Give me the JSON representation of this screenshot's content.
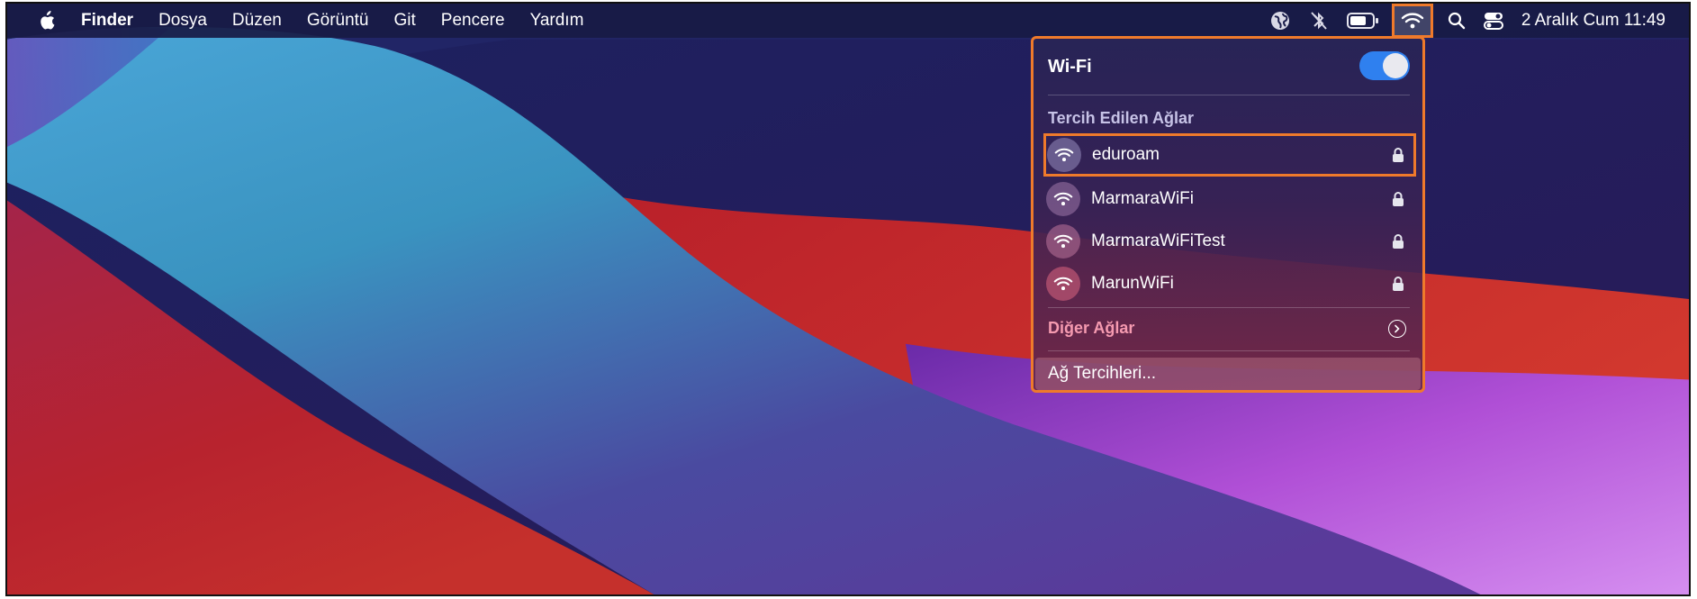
{
  "menubar": {
    "items": [
      {
        "label": "Finder",
        "bold": true
      },
      {
        "label": "Dosya"
      },
      {
        "label": "Düzen"
      },
      {
        "label": "Görüntü"
      },
      {
        "label": "Git"
      },
      {
        "label": "Pencere"
      },
      {
        "label": "Yardım"
      }
    ],
    "status_icons": [
      "globe-icon",
      "bluetooth-off-icon",
      "battery-icon",
      "wifi-icon",
      "search-icon",
      "control-center-icon"
    ],
    "clock": "2 Aralık Cum  11:49"
  },
  "wifi_panel": {
    "title": "Wi-Fi",
    "wifi_on": true,
    "preferred_label": "Tercih Edilen Ağlar",
    "networks": [
      {
        "name": "eduroam",
        "locked": true,
        "selected": true
      },
      {
        "name": "MarmaraWiFi",
        "locked": true,
        "selected": false
      },
      {
        "name": "MarmaraWiFiTest",
        "locked": true,
        "selected": false
      },
      {
        "name": "MarunWiFi",
        "locked": true,
        "selected": false
      }
    ],
    "other_networks_label": "Diğer Ağlar",
    "network_prefs_label": "Ağ Tercihleri..."
  },
  "colors": {
    "highlight": "#ef7a2b",
    "toggle_on": "#2f80ef",
    "menubar_bg": "#181a44"
  }
}
